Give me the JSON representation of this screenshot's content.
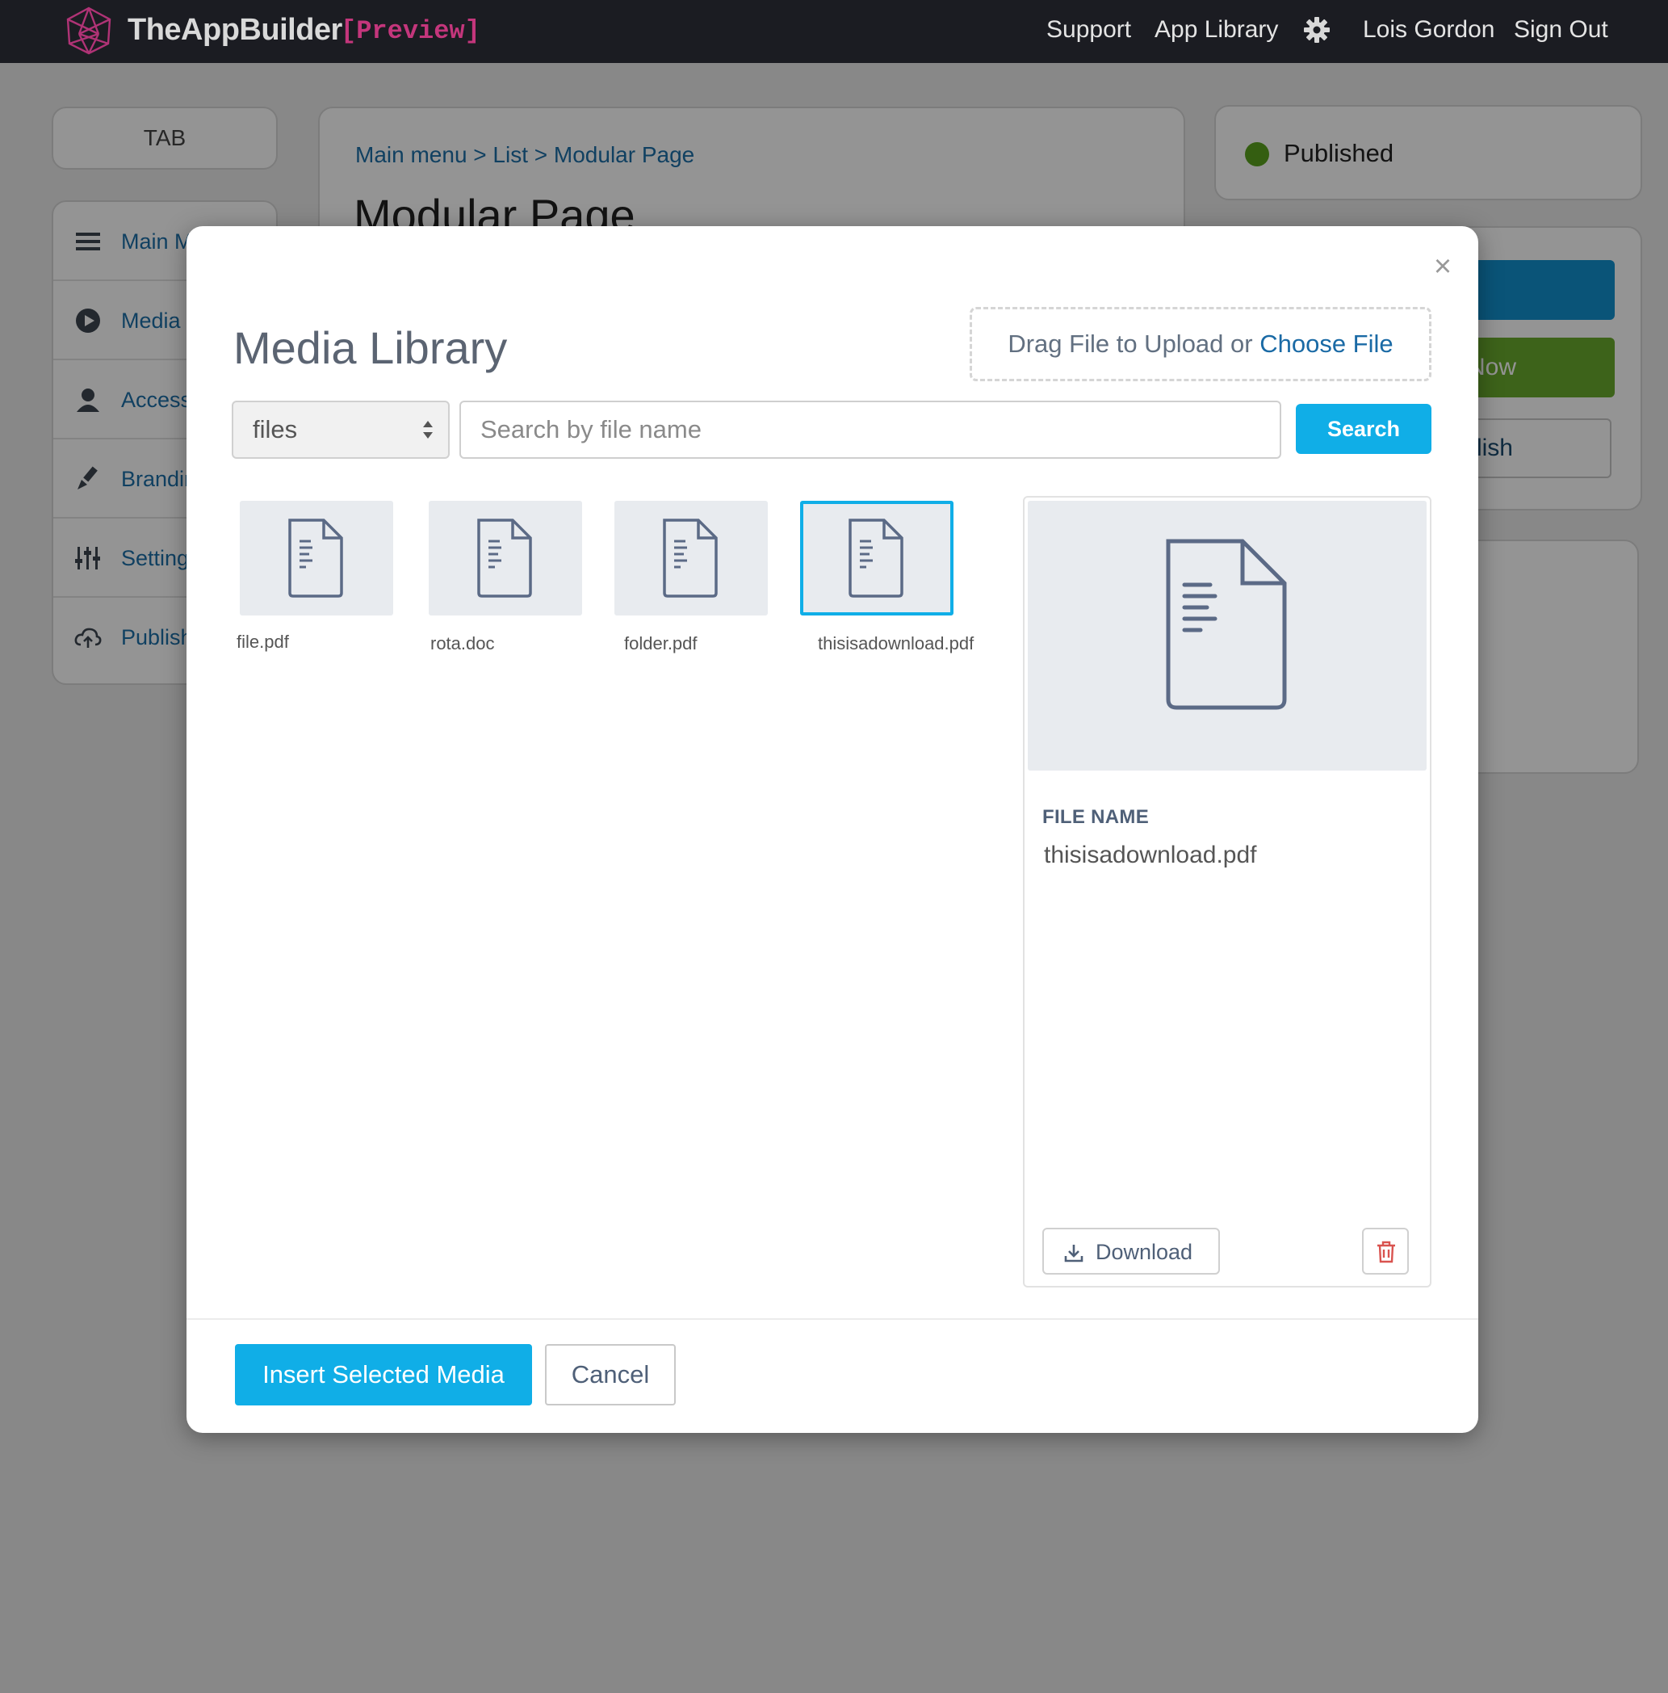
{
  "topbar": {
    "brand": "TheAppBuilder",
    "brand_tag": "[Preview]",
    "nav": {
      "support": "Support",
      "app_library": "App Library",
      "settings_icon": "gear-icon",
      "user_name": "Lois Gordon",
      "sign_out": "Sign Out"
    }
  },
  "sidebar": {
    "tab_label": "TAB",
    "items": [
      {
        "label": "Main M",
        "icon": "menu-icon"
      },
      {
        "label": "Media",
        "icon": "play-circle-icon"
      },
      {
        "label": "Access",
        "icon": "user-icon"
      },
      {
        "label": "Brandin",
        "icon": "brush-icon"
      },
      {
        "label": "Settings",
        "icon": "sliders-icon"
      },
      {
        "label": "Publish",
        "icon": "cloud-upload-icon"
      }
    ]
  },
  "content": {
    "breadcrumb": "Main menu > List > Modular Page",
    "page_title": "Modular Page"
  },
  "status": {
    "label": "Published",
    "color": "#5ba31e"
  },
  "actions": {
    "publish_now_partial": "Now",
    "unpublish_partial": "ublish"
  },
  "modal": {
    "title": "Media Library",
    "close_glyph": "×",
    "dropzone": {
      "text": "Drag File to Upload or",
      "link": "Choose File"
    },
    "filter": {
      "selected": "files"
    },
    "search": {
      "placeholder": "Search by file name",
      "value": "",
      "button": "Search"
    },
    "files": [
      {
        "name": "file.pdf",
        "selected": false
      },
      {
        "name": "rota.doc",
        "selected": false
      },
      {
        "name": "folder.pdf",
        "selected": false
      },
      {
        "name": "thisisadownload.pdf",
        "selected": true
      }
    ],
    "details": {
      "file_name_label": "FILE NAME",
      "file_name": "thisisadownload.pdf",
      "download_label": "Download"
    },
    "footer": {
      "insert_label": "Insert Selected Media",
      "cancel_label": "Cancel"
    }
  },
  "colors": {
    "accent": "#10aee7",
    "link": "#1a6aa5",
    "topbar": "#1b1c22",
    "brand_tag": "#c4367c",
    "danger": "#d9534f"
  }
}
